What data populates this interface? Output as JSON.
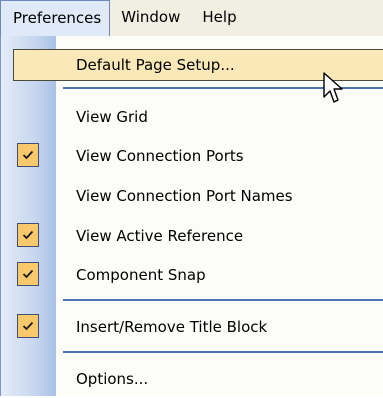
{
  "menubar": {
    "items": [
      {
        "label": "Preferences",
        "active": true
      },
      {
        "label": "Window",
        "active": false
      },
      {
        "label": "Help",
        "active": false
      }
    ]
  },
  "menu": {
    "items": [
      {
        "label": "Default Page Setup...",
        "checked": false,
        "highlighted": true
      },
      {
        "label": "View Grid",
        "checked": false
      },
      {
        "label": "View Connection Ports",
        "checked": true
      },
      {
        "label": "View Connection Port Names",
        "checked": false
      },
      {
        "label": "View Active Reference",
        "checked": true
      },
      {
        "label": "Component Snap",
        "checked": true
      },
      {
        "label": "Insert/Remove Title Block",
        "checked": true
      },
      {
        "label": "Options...",
        "checked": false
      }
    ]
  },
  "icons": {
    "checkmark": "checkmark-icon",
    "cursor": "mouse-pointer-icon"
  },
  "colors": {
    "highlight": "#fbe8b8",
    "check_box": "#fbc96c",
    "separator": "#4f73b0",
    "gutter": "#c8d7ef"
  }
}
